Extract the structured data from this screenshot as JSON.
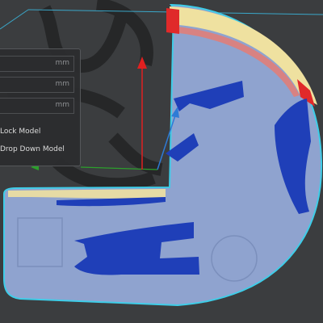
{
  "scale_panel": {
    "fields": [
      {
        "unit": "mm"
      },
      {
        "unit": "mm"
      },
      {
        "unit": "mm"
      }
    ],
    "lock_model_label": "Lock Model",
    "drop_down_model_label": "Drop Down Model"
  },
  "viewport": {
    "axis_y_color": "#e02020",
    "axis_x_color": "#2ca02c",
    "axis_z_color": "#2e7bd6",
    "model_fill_color": "#8fa3cf",
    "model_outline_color": "#3ecde8",
    "model_top_color": "#efe1a0",
    "overhang_color": "#1f3fb8",
    "bed_color": "#3b3d3f"
  }
}
